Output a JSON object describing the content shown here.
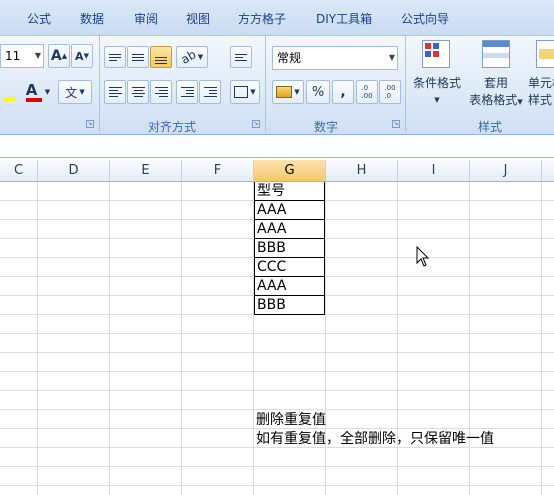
{
  "tabs": [
    "公式",
    "数据",
    "审阅",
    "视图",
    "方方格子",
    "DIY工具箱",
    "公式向导"
  ],
  "font": {
    "size": "11",
    "grow_icon": "A",
    "shrink_icon": "A",
    "color_icon": "A",
    "phonetic_icon": "文"
  },
  "alignment": {
    "group_label": "对齐方式"
  },
  "number": {
    "format": "常规",
    "group_label": "数字",
    "percent": "%",
    "comma": ",",
    "inc_decimal": ".0→.00",
    "dec_decimal": ".00→.0"
  },
  "styles": {
    "group_label": "样式",
    "conditional_format": "条件格式",
    "table_format_line1": "套用",
    "table_format_line2": "表格格式",
    "cell_style_line1": "单元格",
    "cell_style_line2": "样式"
  },
  "columns": [
    "C",
    "D",
    "E",
    "F",
    "G",
    "H",
    "I",
    "J"
  ],
  "selected_column": "G",
  "cells": {
    "header": "型号",
    "values": [
      "AAA",
      "AAA",
      "BBB",
      "CCC",
      "AAA",
      "BBB"
    ]
  },
  "notes": {
    "line1": "删除重复值",
    "line2": "如有重复值，全部删除，只保留唯一值"
  }
}
